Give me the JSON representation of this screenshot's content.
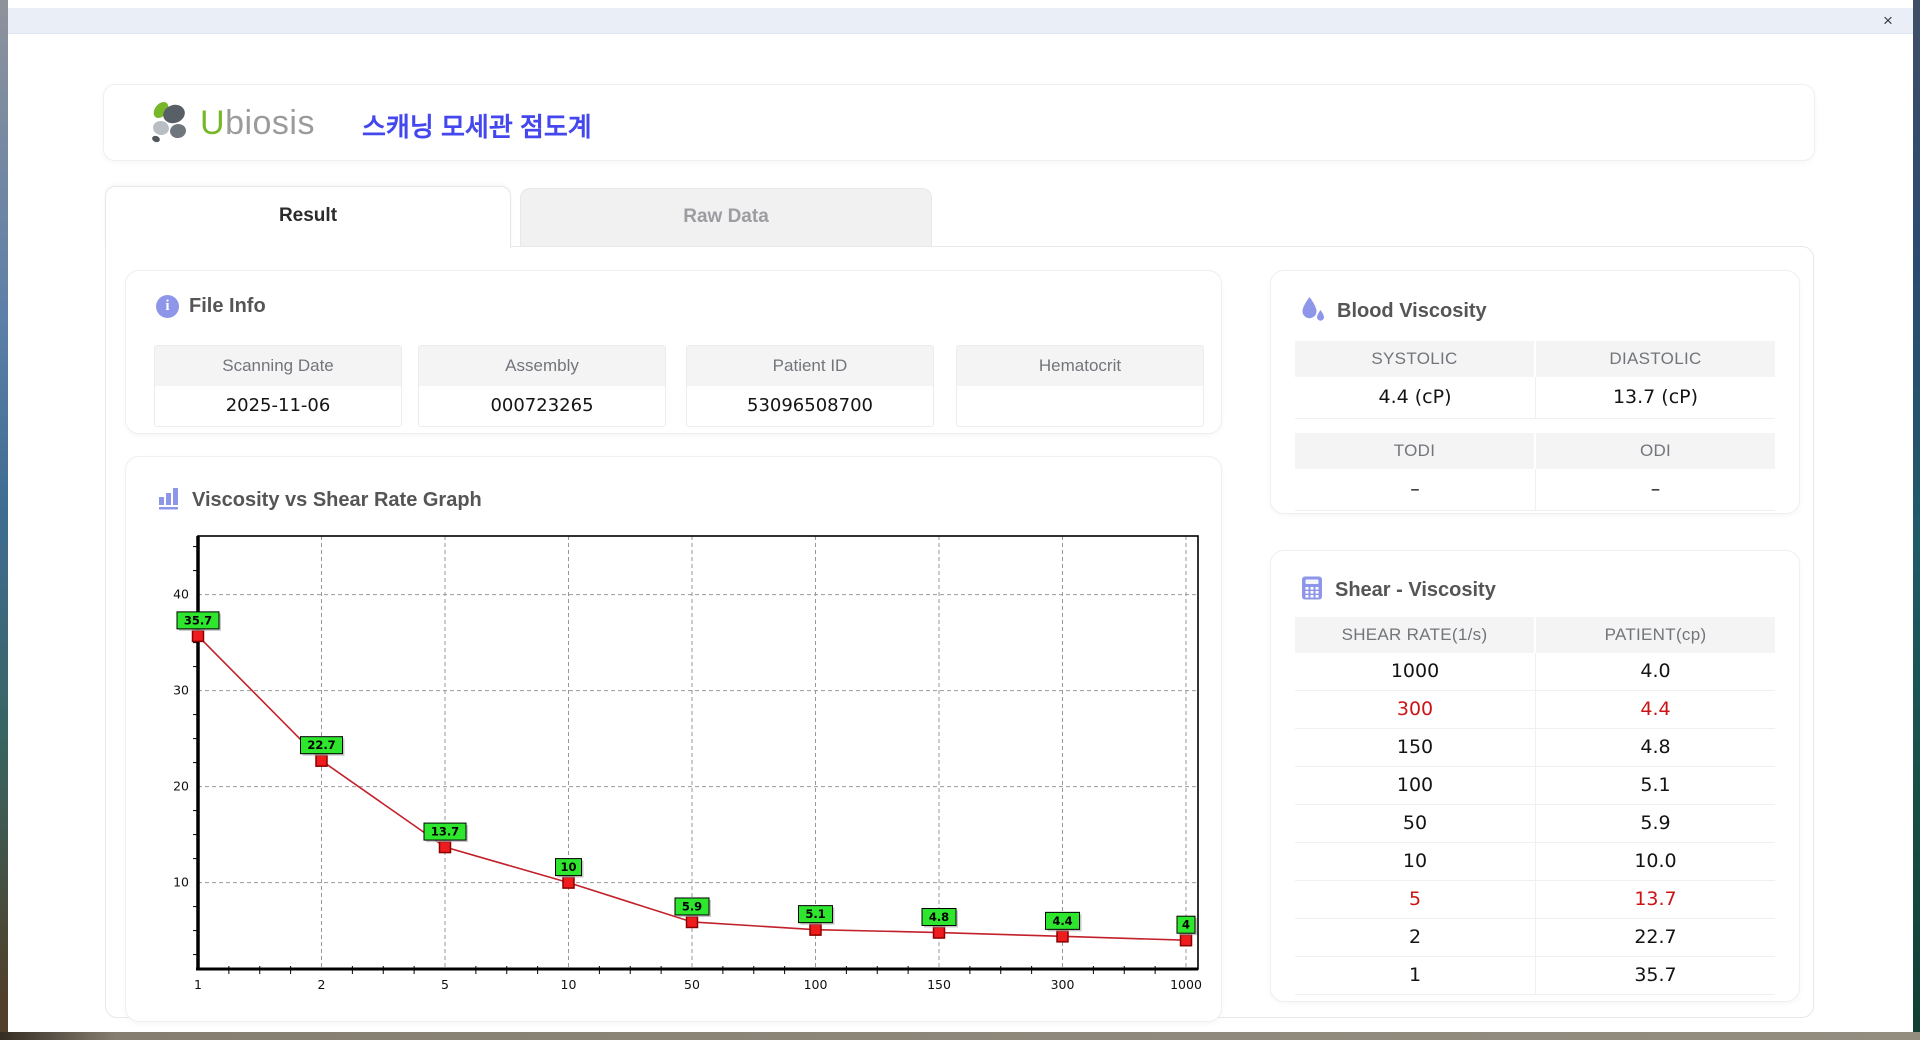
{
  "window": {
    "close_label": "×"
  },
  "header": {
    "logo_u": "U",
    "logo_rest": "biosis",
    "title_ko": "스캐닝 모세관 점도계"
  },
  "tabs": {
    "result": "Result",
    "raw_data": "Raw Data"
  },
  "file_info": {
    "title": "File Info",
    "fields": [
      {
        "label": "Scanning Date",
        "value": "2025-11-06"
      },
      {
        "label": "Assembly",
        "value": "000723265"
      },
      {
        "label": "Patient ID",
        "value": "53096508700"
      },
      {
        "label": "Hematocrit",
        "value": ""
      }
    ]
  },
  "blood_viscosity": {
    "title": "Blood Viscosity",
    "row1_headers": [
      "SYSTOLIC",
      "DIASTOLIC"
    ],
    "row1_values": [
      "4.4 (cP)",
      "13.7 (cP)"
    ],
    "row2_headers": [
      "TODI",
      "ODI"
    ],
    "row2_values": [
      "–",
      "–"
    ]
  },
  "graph_section": {
    "title": "Viscosity vs Shear Rate Graph"
  },
  "chart_data": {
    "type": "line",
    "title": "Viscosity vs Shear Rate Graph",
    "categories": [
      "1",
      "2",
      "5",
      "10",
      "50",
      "100",
      "150",
      "300",
      "1000"
    ],
    "values": [
      35.7,
      22.7,
      13.7,
      10,
      5.9,
      5.1,
      4.8,
      4.4,
      4
    ],
    "point_labels": [
      "35.7",
      "22.7",
      "13.7",
      "10",
      "5.9",
      "5.1",
      "4.8",
      "4.4",
      "4"
    ],
    "xlabel": "",
    "ylabel": "",
    "y_ticks": [
      10,
      20,
      30,
      40
    ],
    "ylim": [
      1,
      46
    ],
    "grid": "dashed",
    "legend": "none",
    "line_color": "#c2202a",
    "marker_color": "#ee1c1c",
    "marker_border": "#8b0000",
    "label_bg": "#2ee62e",
    "label_border": "#000000",
    "grid_color": "#999999"
  },
  "shear_table": {
    "title": "Shear - Viscosity",
    "columns": [
      "SHEAR RATE(1/s)",
      "PATIENT(cp)"
    ],
    "rows": [
      {
        "shear": "1000",
        "patient": "4.0",
        "highlight": false
      },
      {
        "shear": "300",
        "patient": "4.4",
        "highlight": true
      },
      {
        "shear": "150",
        "patient": "4.8",
        "highlight": false
      },
      {
        "shear": "100",
        "patient": "5.1",
        "highlight": false
      },
      {
        "shear": "50",
        "patient": "5.9",
        "highlight": false
      },
      {
        "shear": "10",
        "patient": "10.0",
        "highlight": false
      },
      {
        "shear": "5",
        "patient": "13.7",
        "highlight": true
      },
      {
        "shear": "2",
        "patient": "22.7",
        "highlight": false
      },
      {
        "shear": "1",
        "patient": "35.7",
        "highlight": false
      }
    ]
  }
}
